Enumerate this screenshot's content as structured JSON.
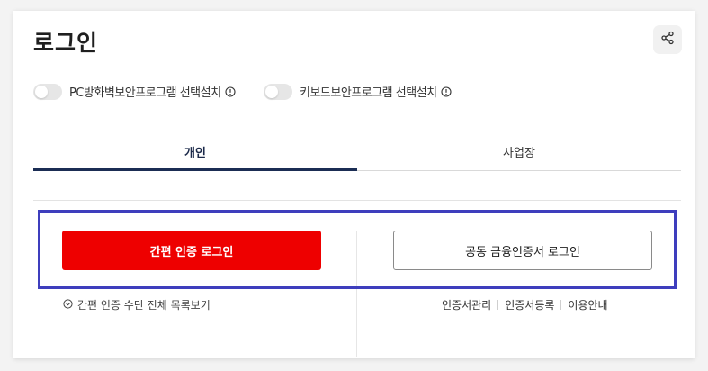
{
  "page": {
    "title": "로그인"
  },
  "share": {
    "icon": "share-icon"
  },
  "toggles": [
    {
      "label": "PC방화벽보안프로그램 선택설치",
      "on": false
    },
    {
      "label": "키보드보안프로그램 선택설치",
      "on": false
    }
  ],
  "tabs": [
    {
      "label": "개인",
      "active": true
    },
    {
      "label": "사업장",
      "active": false
    }
  ],
  "buttons": {
    "simple_login": "간편 인증 로그인",
    "cert_login": "공동 금융인증서 로그인"
  },
  "view_all": "간편 인증 수단 전체 목록보기",
  "links": [
    "인증서관리",
    "인증서등록",
    "이용안내"
  ],
  "colors": {
    "primary_red": "#ee0000",
    "tab_active": "#1b2d54",
    "highlight_box": "#3e3ebd"
  }
}
